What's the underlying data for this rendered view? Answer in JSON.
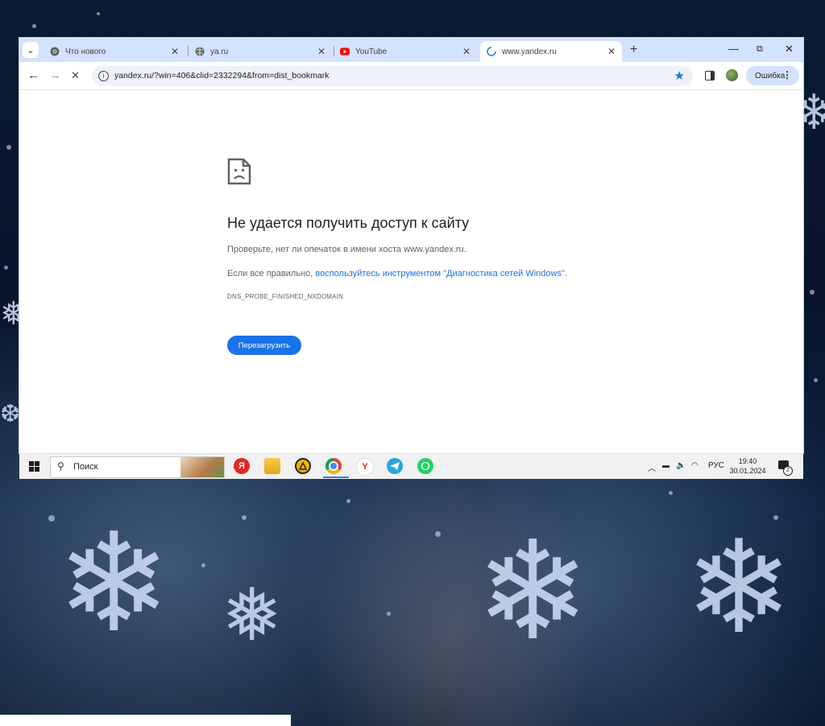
{
  "tabs": [
    {
      "label": "Что нового",
      "icon": "chrome-icon",
      "active": false
    },
    {
      "label": "ya.ru",
      "icon": "globe-icon",
      "active": false
    },
    {
      "label": "YouTube",
      "icon": "youtube-icon",
      "active": false
    },
    {
      "label": "www.yandex.ru",
      "icon": "loading-spinner-icon",
      "active": true
    }
  ],
  "toolbar": {
    "url": "yandex.ru/?win=406&clid=2332294&from=dist_bookmark",
    "error_button_label": "Ошибка"
  },
  "error_page": {
    "title": "Не удается получить доступ к сайту",
    "line1": "Проверьте, нет ли опечаток в имени хоста www.yandex.ru.",
    "line2_prefix": "Если все правильно, ",
    "line2_link": "воспользуйтесь инструментом \"Диагностика сетей Windows\"",
    "line2_suffix": ".",
    "error_code": "DNS_PROBE_FINISHED_NXDOMAIN",
    "reload_label": "Перезагрузить"
  },
  "taskbar": {
    "search_placeholder": "Поиск",
    "apps": [
      "yandex-browser-icon",
      "file-explorer-icon",
      "app-triangle-icon",
      "chrome-icon",
      "yandex-icon",
      "telegram-icon",
      "whatsapp-icon"
    ],
    "language": "РУС",
    "time": "19:40",
    "date": "30.01.2024",
    "notification_count": "2"
  },
  "colors": {
    "accent": "#1a73e8",
    "tabbar": "#d3e3fd",
    "omnibox": "#edf2fa"
  }
}
